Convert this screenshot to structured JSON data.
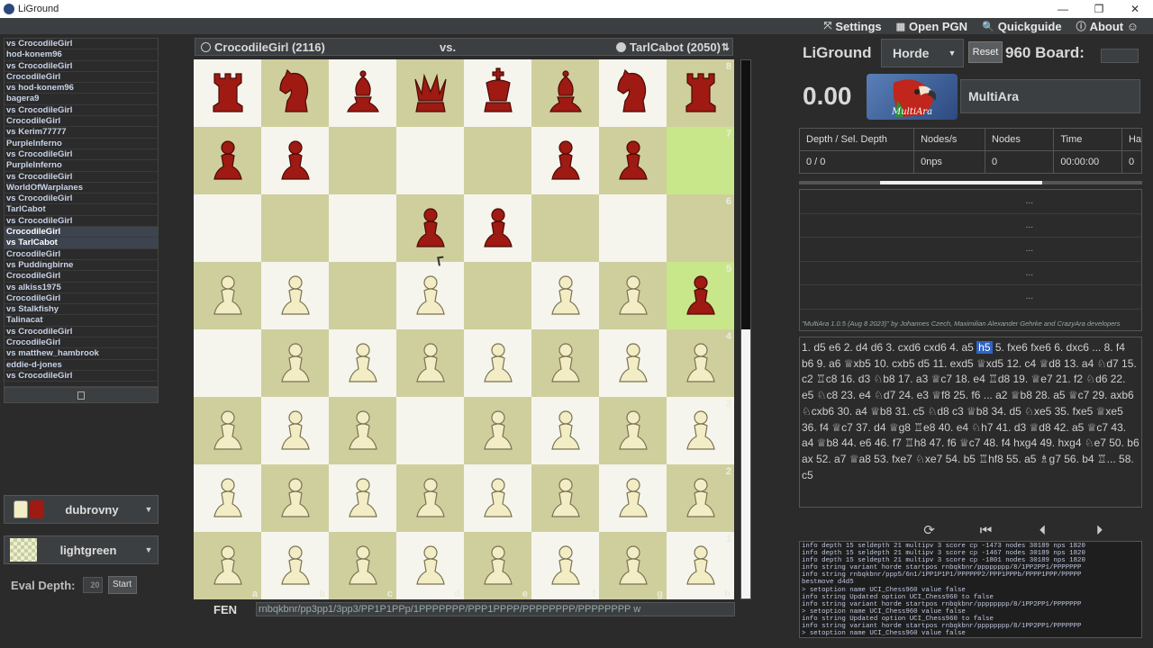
{
  "window": {
    "title": "LiGround",
    "controls": [
      "—",
      "❐",
      "✕"
    ]
  },
  "menu": [
    {
      "icon": "tools-icon",
      "glyph": "⤧",
      "label": "Settings"
    },
    {
      "icon": "chessboard-icon",
      "glyph": "▦",
      "label": "Open PGN"
    },
    {
      "icon": "search-icon",
      "glyph": "🔍",
      "label": "Quickguide"
    },
    {
      "icon": "info-icon",
      "glyph": "ⓘ",
      "label": "About ☺"
    }
  ],
  "game_list": [
    {
      "text": "vs CrocodileGirl",
      "selected": false
    },
    {
      "text": "hod-konem96",
      "selected": false
    },
    {
      "text": "vs CrocodileGirl",
      "selected": false
    },
    {
      "text": "CrocodileGirl",
      "selected": false
    },
    {
      "text": "vs hod-konem96",
      "selected": false
    },
    {
      "text": "bagera9",
      "selected": false
    },
    {
      "text": "vs CrocodileGirl",
      "selected": false
    },
    {
      "text": "CrocodileGirl",
      "selected": false
    },
    {
      "text": "vs Kerim77777",
      "selected": false
    },
    {
      "text": "PurpleInferno",
      "selected": false
    },
    {
      "text": "vs CrocodileGirl",
      "selected": false
    },
    {
      "text": "PurpleInferno",
      "selected": false
    },
    {
      "text": "vs CrocodileGirl",
      "selected": false
    },
    {
      "text": "WorldOfWarplanes",
      "selected": false
    },
    {
      "text": "vs CrocodileGirl",
      "selected": false
    },
    {
      "text": "TarlCabot",
      "selected": false
    },
    {
      "text": "vs CrocodileGirl",
      "selected": false
    },
    {
      "text": "CrocodileGirl",
      "selected": true
    },
    {
      "text": "vs TarlCabot",
      "selected": true
    },
    {
      "text": "CrocodileGirl",
      "selected": false
    },
    {
      "text": "vs Puddingbirne",
      "selected": false
    },
    {
      "text": "CrocodileGirl",
      "selected": false
    },
    {
      "text": "vs alkiss1975",
      "selected": false
    },
    {
      "text": "CrocodileGirl",
      "selected": false
    },
    {
      "text": "vs Stalkfishy",
      "selected": false
    },
    {
      "text": "Talinacat",
      "selected": false
    },
    {
      "text": "vs CrocodileGirl",
      "selected": false
    },
    {
      "text": "CrocodileGirl",
      "selected": false
    },
    {
      "text": "vs matthew_hambrook",
      "selected": false
    },
    {
      "text": "eddie-d-jones",
      "selected": false
    },
    {
      "text": "vs CrocodileGirl",
      "selected": false
    }
  ],
  "piece_set": {
    "label": "dubrovny"
  },
  "board_theme": {
    "label": "lightgreen"
  },
  "eval_depth": {
    "label": "Eval Depth:",
    "value": "20",
    "start_label": "Start"
  },
  "header": {
    "white_player": "CrocodileGirl (2116)",
    "vs": "vs.",
    "black_player": "TarlCabot (2050)",
    "flip_glyph": "⇅"
  },
  "board": {
    "rows": [
      "rnbqkbnr",
      "pp...pp.",
      "...pp...",
      "PP.P.PPp",
      ".PPPPPPP",
      "PPP.PPPP",
      "PPPPPPPP",
      "PPPPPPPP"
    ],
    "highlights": [
      "h7",
      "h5"
    ],
    "files": [
      "a",
      "b",
      "c",
      "d",
      "e",
      "f",
      "g",
      "h"
    ],
    "ranks": [
      "8",
      "7",
      "6",
      "5",
      "4",
      "3",
      "2",
      "1"
    ],
    "colors": {
      "light": "#f5f5ee",
      "dark": "#cfcf9e",
      "highlight": "#c8e68a",
      "white_piece": "#f3edc6",
      "black_piece": "#9e1a12"
    }
  },
  "eval_bar_white_fraction": 0.5,
  "fen": {
    "label": "FEN",
    "value": "rnbqkbnr/pp3pp1/3pp3/PP1P1PPp/1PPPPPPP/PPP1PPPP/PPPPPPPP/PPPPPPPP w"
  },
  "engine_panel": {
    "app_name": "LiGround",
    "variant": "Horde",
    "reset_label": "Reset",
    "b960_label": "960 Board:",
    "score": "0.00",
    "engine_logo_text": "MultiAra",
    "engine_name": "MultiAra",
    "stats_headers": [
      "Depth / Sel. Depth",
      "Nodes/s",
      "Nodes",
      "Time",
      "Ha"
    ],
    "stats_values": [
      "0 / 0",
      "0nps",
      "0",
      "00:00:00",
      "0"
    ],
    "pv_lines": [
      "...",
      "...",
      "...",
      "...",
      "..."
    ],
    "credits": "\"MultiAra 1.0.5 (Aug 8 2023)\" by Johannes Czech, Maximilian Alexander Gehrke and CrazyAra developers"
  },
  "moves": {
    "before_highlight": "1. d5 e6 2. d4 d6 3. cxd6 cxd6 4. a5 ",
    "highlight": "h5",
    "after_highlight": " 5. fxe6 fxe6 6. dxc6 ... 8. f4 b6 9. a6 ♕xb5 10. cxb5 d5 11. exd5 ♕xd5 12. c4 ♕d8 13. a4 ♘d7 15. c2 ♖c8 16. d3 ♘b8 17. a3 ♕c7 18. e4 ♖d8 19. ♕e7 21. f2 ♘d6 22. e5 ♘c8 23. e4 ♘d7 24. e3 ♕f8 25. f6 ... a2 ♕b8 28. a5 ♕c7 29. axb6 ♘cxb6 30. a4 ♕b8 31. c5 ♘d8 c3 ♕b8 34. d5 ♘xe5 35. fxe5 ♕xe5 36. f4 ♕c7 37. d4 ♕g8 ♖e8 40. e4 ♘h7 41. d3 ♕d8 42. a5 ♕c7 43. a4 ♕b8 44. e6 46. f7 ♖h8 47. f6 ♕c7 48. f4 hxg4 49. hxg4 ♘e7 50. b6 ax 52. a7 ♕a8 53. fxe7 ♘xe7 54. b5 ♖hf8 55. a5 ♗g7 56. b4 ♖... 58. c5"
  },
  "nav": [
    "⟳",
    "⏮",
    "⏴",
    "⏵",
    "⏭"
  ],
  "console_lines": [
    "info depth 15 seldepth 21 multipv 3 score cp -1473 nodes 30189 nps 1820",
    "info depth 15 seldepth 21 multipv 3 score cp -1467 nodes 30189 nps 1820",
    "info depth 15 seldepth 21 multipv 3 score cp -1801 nodes 30189 nps 1820",
    "info string variant horde startpos rnbqkbnr/pppppppp/8/1PP2PP1/PPPPPPP",
    "info string rnbqkbnr/ppp5/6n1/1PP1P1P1/PPPPPP2/PPP1PPPb/PPPP1PPP/PPPPP",
    "bestmove d4d5",
    "> setoption name UCI_Chess960 value false",
    "info string Updated option UCI_Chess960 to false",
    "info string variant horde startpos rnbqkbnr/pppppppp/8/1PP2PP1/PPPPPPP",
    "> setoption name UCI_Chess960 value false",
    "info string Updated option UCI_Chess960 to false",
    "info string variant horde startpos rnbqkbnr/pppppppp/8/1PP2PP1/PPPPPPP",
    "> setoption name UCI_Chess960 value false"
  ]
}
